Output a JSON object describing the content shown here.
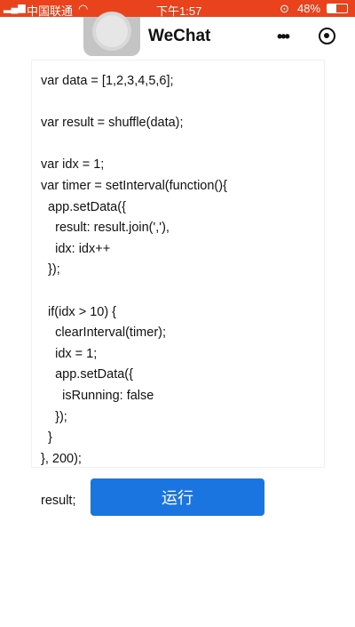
{
  "status": {
    "carrier": "中国联通",
    "time": "下午1:57",
    "battery": "48%"
  },
  "nav": {
    "title": "WeChat",
    "more_icon": "more-dots-icon",
    "home_icon": "target-icon"
  },
  "code": {
    "lines": [
      "var data = [1,2,3,4,5,6];",
      "",
      "var result = shuffle(data);",
      "",
      "var idx = 1;",
      "var timer = setInterval(function(){",
      "  app.setData({",
      "    result: result.join(','),",
      "    idx: idx++",
      "  });",
      "",
      "  if(idx > 10) {",
      "    clearInterval(timer);",
      "    idx = 1;",
      "    app.setData({",
      "      isRunning: false",
      "    });",
      "  }",
      "}, 200);",
      "",
      "result;"
    ]
  },
  "run_button": {
    "label": "运行",
    "color": "#1a75e0"
  }
}
